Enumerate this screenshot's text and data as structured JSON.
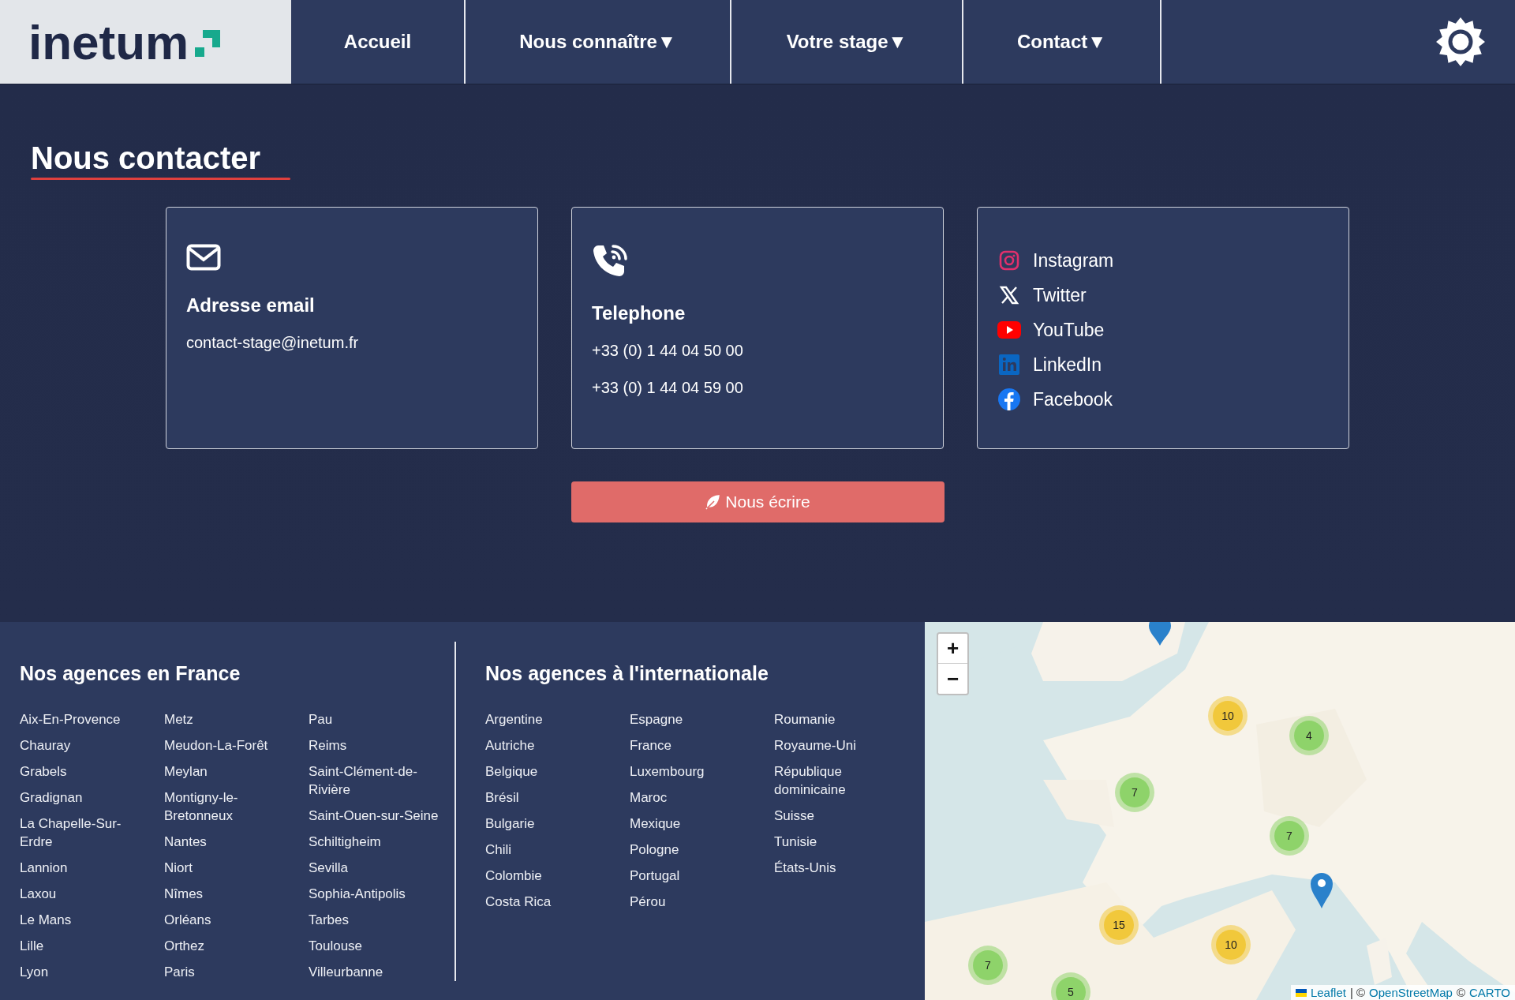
{
  "header": {
    "logo": "inetum",
    "nav": [
      {
        "label": "Accueil"
      },
      {
        "label": "Nous connaître",
        "caret": "▼"
      },
      {
        "label": "Votre stage",
        "caret": "▼"
      },
      {
        "label": "Contact",
        "caret": "▼"
      }
    ]
  },
  "contact": {
    "title": "Nous contacter",
    "email": {
      "title": "Adresse email",
      "lines": [
        "contact-stage@inetum.fr"
      ]
    },
    "phone": {
      "title": "Telephone",
      "lines": [
        "+33 (0) 1 44 04 50 00",
        "+33 (0) 1 44 04 59 00"
      ]
    },
    "social": [
      {
        "kind": "instagram",
        "label": "Instagram"
      },
      {
        "kind": "twitter",
        "label": "Twitter"
      },
      {
        "kind": "youtube",
        "label": "YouTube"
      },
      {
        "kind": "linkedin",
        "label": "LinkedIn"
      },
      {
        "kind": "facebook",
        "label": "Facebook"
      }
    ],
    "button": "Nous écrire"
  },
  "agencies": [
    {
      "title": "Nos agences en France",
      "columns": [
        [
          "Aix-En-Provence",
          "Chauray",
          "Grabels",
          "Gradignan",
          "La Chapelle-Sur-Erdre",
          "Lannion",
          "Laxou",
          "Le Mans",
          "Lille",
          "Lyon"
        ],
        [
          "Metz",
          "Meudon-La-Forêt",
          "Meylan",
          "Montigny-le-Bretonneux",
          "Nantes",
          "Niort",
          "Nîmes",
          "Orléans",
          "Orthez",
          "Paris"
        ],
        [
          "Pau",
          "Reims",
          "Saint-Clément-de-Rivière",
          "Saint-Ouen-sur-Seine",
          "Schiltigheim",
          "Sevilla",
          "Sophia-Antipolis",
          "Tarbes",
          "Toulouse",
          "Villeurbanne"
        ]
      ]
    },
    {
      "title": "Nos agences à l'internationale",
      "columns": [
        [
          "Argentine",
          "Autriche",
          "Belgique",
          "Brésil",
          "Bulgarie",
          "Chili",
          "Colombie",
          "Costa Rica"
        ],
        [
          "Espagne",
          "France",
          "Luxembourg",
          "Maroc",
          "Mexique",
          "Pologne",
          "Portugal",
          "Pérou"
        ],
        [
          "Roumanie",
          "Royaume-Uni",
          "République dominicaine",
          "Suisse",
          "Tunisie",
          "États-Unis"
        ]
      ]
    }
  ],
  "map": {
    "zoom_in": "+",
    "zoom_out": "−",
    "clusters": [
      {
        "count": "10",
        "color": "#f1c83b"
      },
      {
        "count": "4",
        "color": "#8ed36a"
      },
      {
        "count": "7",
        "color": "#8ed36a"
      },
      {
        "count": "7",
        "color": "#8ed36a"
      },
      {
        "count": "15",
        "color": "#f1c83b"
      },
      {
        "count": "10",
        "color": "#f1c83b"
      },
      {
        "count": "7",
        "color": "#8ed36a"
      },
      {
        "count": "5",
        "color": "#8ed36a"
      }
    ],
    "attribution": {
      "leaflet": "Leaflet",
      "separator": "| ©",
      "osm": "OpenStreetMap",
      "copy": "©",
      "carto": "CARTO"
    }
  }
}
